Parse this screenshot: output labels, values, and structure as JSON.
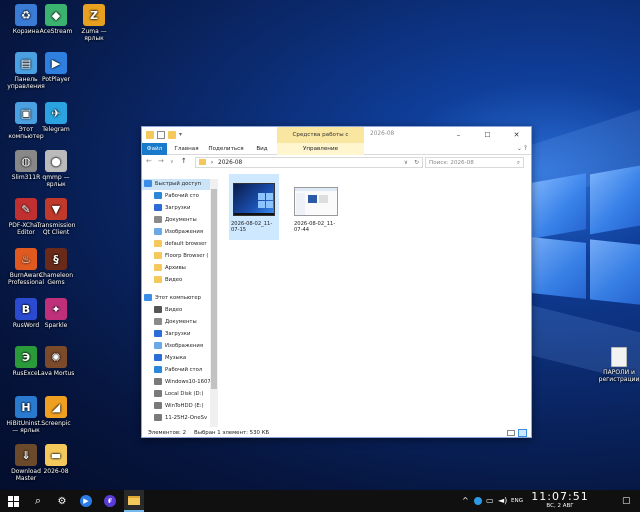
{
  "desktop": {
    "icons_left": [
      {
        "label": "Корзина",
        "icon": "recycle-bin-icon"
      },
      {
        "label": "AceStream",
        "icon": "acestream-icon"
      },
      {
        "label": "Zuma — ярлык",
        "icon": "zuma-icon"
      },
      {
        "label": "Панель управления",
        "icon": "control-panel-icon"
      },
      {
        "label": "PotPlayer",
        "icon": "potplayer-icon"
      },
      {
        "label": "Этот компьютер",
        "icon": "computer-icon"
      },
      {
        "label": "Telegram",
        "icon": "telegram-icon"
      },
      {
        "label": "Slim311R",
        "icon": "slim-icon"
      },
      {
        "label": "qmmp — ярлык",
        "icon": "qmmp-icon"
      },
      {
        "label": "PDF-XCha... Editor",
        "icon": "pdf-editor-icon"
      },
      {
        "label": "Transmission Qt Client",
        "icon": "transmission-icon"
      },
      {
        "label": "BurnAware Professional",
        "icon": "burnaware-icon"
      },
      {
        "label": "Chameleon Gems",
        "icon": "chameleon-icon"
      },
      {
        "label": "RusWord",
        "icon": "rusword-icon"
      },
      {
        "label": "Sparkle",
        "icon": "sparkle-icon"
      },
      {
        "label": "RusExcel",
        "icon": "rusexcel-icon"
      },
      {
        "label": "Lava Mortus",
        "icon": "lava-mortus-icon"
      },
      {
        "label": "HiBitUninst... — ярлык",
        "icon": "hibit-icon"
      },
      {
        "label": "Screenpic",
        "icon": "screenpic-icon"
      },
      {
        "label": "Download Master",
        "icon": "download-master-icon"
      },
      {
        "label": "2026-08",
        "icon": "folder-icon"
      }
    ],
    "icon_right": {
      "label": "ПАРОЛИ и регистрации",
      "icon": "document-icon"
    }
  },
  "window": {
    "title": "2026-08",
    "context_tab": "Средства работы с рисунками",
    "tabs": [
      {
        "label": "Файл"
      },
      {
        "label": "Главная"
      },
      {
        "label": "Поделиться"
      },
      {
        "label": "Вид"
      },
      {
        "label": "Управление"
      }
    ],
    "address": {
      "path": "2026-08",
      "separator": "›"
    },
    "search_placeholder": "Поиск: 2026-08",
    "nav_items": [
      {
        "label": "Быстрый доступ",
        "color": "#3b8ee8"
      },
      {
        "label": "Рабочий сто",
        "color": "#2b88d8"
      },
      {
        "label": "Загрузки",
        "color": "#2b6cd8"
      },
      {
        "label": "Документы",
        "color": "#8a8a8a"
      },
      {
        "label": "Изображения",
        "color": "#6aa8e8"
      },
      {
        "label": "default browser",
        "color": "#f4c85a"
      },
      {
        "label": "Floorp Browser (",
        "color": "#f4c85a"
      },
      {
        "label": "Архивы",
        "color": "#f4c85a"
      },
      {
        "label": "Видео",
        "color": "#f4c85a"
      },
      {
        "label": "Этот компьютер",
        "color": "#3b8ee8"
      },
      {
        "label": "Видео",
        "color": "#555555"
      },
      {
        "label": "Документы",
        "color": "#8a8a8a"
      },
      {
        "label": "Загрузки",
        "color": "#2b6cd8"
      },
      {
        "label": "Изображения",
        "color": "#6aa8e8"
      },
      {
        "label": "Музыка",
        "color": "#2b6cd8"
      },
      {
        "label": "Рабочий стол",
        "color": "#2b88d8"
      },
      {
        "label": "Windows10-1607",
        "color": "#7a7a7a"
      },
      {
        "label": "Local Disk (D:)",
        "color": "#7a7a7a"
      },
      {
        "label": "WinToHDD (E:)",
        "color": "#7a7a7a"
      },
      {
        "label": "11-25H2-OneSv",
        "color": "#7a7a7a"
      }
    ],
    "files": [
      {
        "name": "2026-08-02_11-07-15",
        "selected": true
      },
      {
        "name": "2026-08-02_11-07-44",
        "selected": false
      }
    ],
    "status": {
      "count": "Элементов: 2",
      "selection": "Выбран 1 элемент: 530 КБ"
    }
  },
  "taskbar": {
    "lang": "ENG",
    "time": "11:07:51",
    "date": "ВС, 2  АВГ",
    "apps": [
      "start-icon",
      "search-icon",
      "settings-icon",
      "media-player-icon",
      "floorp-icon",
      "explorer-icon"
    ]
  },
  "colors": {
    "accent": "#1979ca",
    "context_tab": "#f9e6a1",
    "selection": "#cde8ff"
  }
}
